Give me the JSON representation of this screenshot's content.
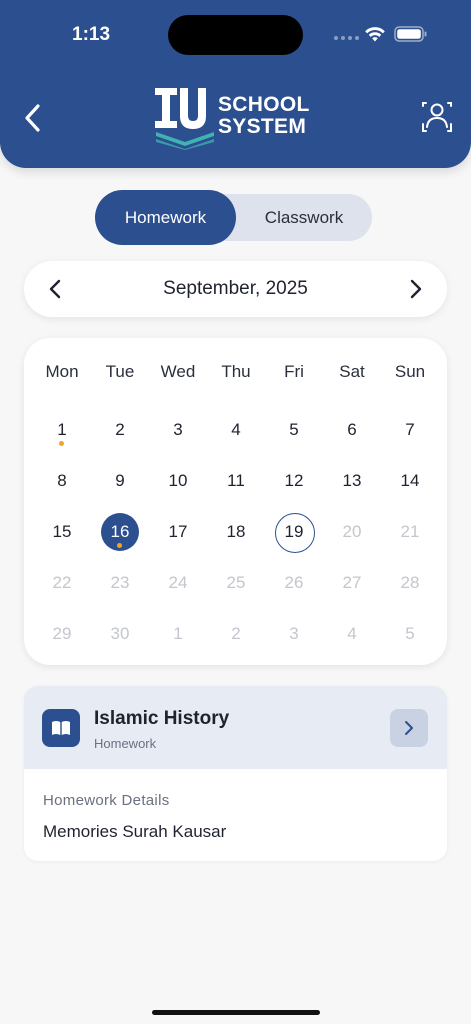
{
  "status_bar": {
    "time": "1:13"
  },
  "header": {
    "logo_line1": "SCHOOL",
    "logo_line2": "SYSTEM",
    "brand_color": "#2c4f8f",
    "accent_color": "#3fb3b2"
  },
  "toggle": {
    "active": "Homework",
    "inactive": "Classwork"
  },
  "calendar": {
    "month_label": "September, 2025",
    "weekdays": [
      "Mon",
      "Tue",
      "Wed",
      "Thu",
      "Fri",
      "Sat",
      "Sun"
    ],
    "weeks": [
      [
        {
          "d": "1",
          "dot": true
        },
        {
          "d": "2"
        },
        {
          "d": "3"
        },
        {
          "d": "4"
        },
        {
          "d": "5"
        },
        {
          "d": "6"
        },
        {
          "d": "7"
        }
      ],
      [
        {
          "d": "8"
        },
        {
          "d": "9"
        },
        {
          "d": "10"
        },
        {
          "d": "11"
        },
        {
          "d": "12"
        },
        {
          "d": "13"
        },
        {
          "d": "14"
        }
      ],
      [
        {
          "d": "15"
        },
        {
          "d": "16",
          "selected": true,
          "dot": true
        },
        {
          "d": "17"
        },
        {
          "d": "18"
        },
        {
          "d": "19",
          "today": true
        },
        {
          "d": "20",
          "muted": true
        },
        {
          "d": "21",
          "muted": true
        }
      ],
      [
        {
          "d": "22",
          "muted": true
        },
        {
          "d": "23",
          "muted": true
        },
        {
          "d": "24",
          "muted": true
        },
        {
          "d": "25",
          "muted": true
        },
        {
          "d": "26",
          "muted": true
        },
        {
          "d": "27",
          "muted": true
        },
        {
          "d": "28",
          "muted": true
        }
      ],
      [
        {
          "d": "29",
          "muted": true
        },
        {
          "d": "30",
          "muted": true
        },
        {
          "d": "1",
          "muted": true
        },
        {
          "d": "2",
          "muted": true
        },
        {
          "d": "3",
          "muted": true
        },
        {
          "d": "4",
          "muted": true
        },
        {
          "d": "5",
          "muted": true
        }
      ]
    ],
    "dot_color": "#f0a623"
  },
  "homework": {
    "subject": "Islamic History",
    "type": "Homework",
    "details_label": "Homework Details",
    "details_text": "Memories Surah Kausar",
    "icon": "book-icon"
  }
}
